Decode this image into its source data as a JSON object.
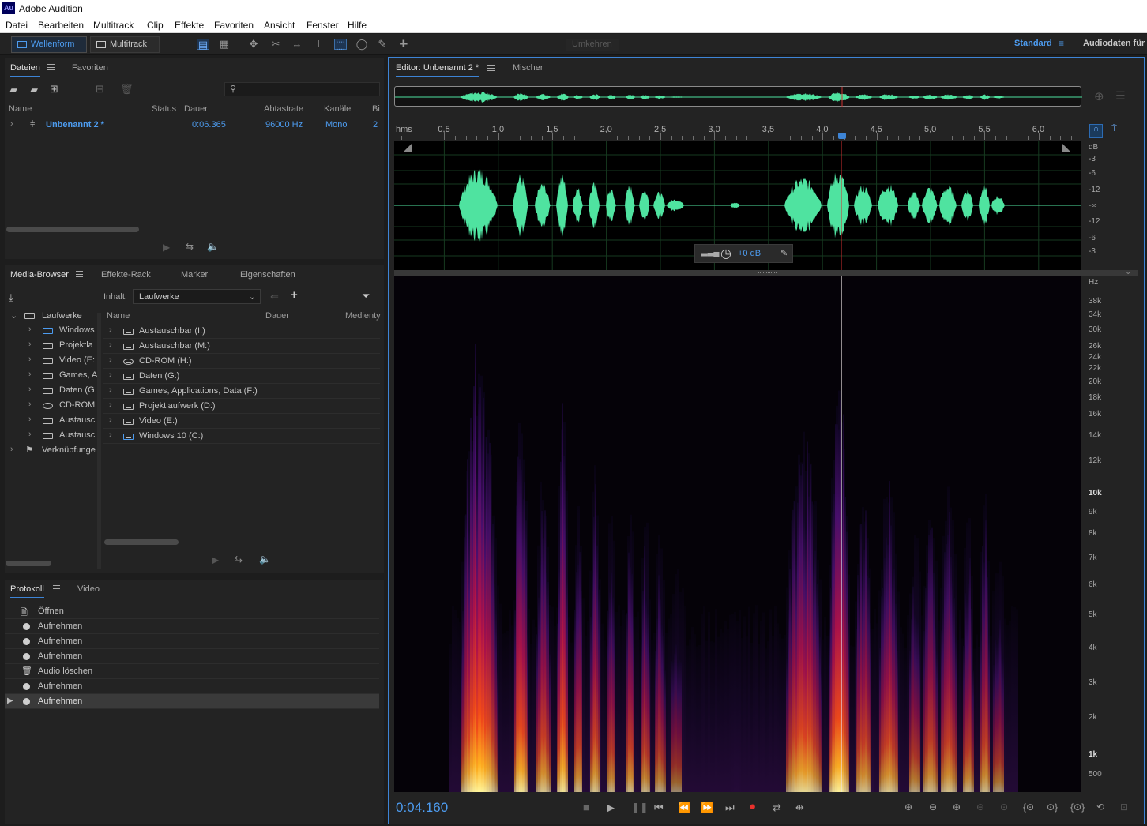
{
  "app": {
    "title": "Adobe Audition",
    "logo": "Au"
  },
  "menu": [
    "Datei",
    "Bearbeiten",
    "Multitrack",
    "Clip",
    "Effekte",
    "Favoriten",
    "Ansicht",
    "Fenster",
    "Hilfe"
  ],
  "toolbar": {
    "waveform_label": "Wellenform",
    "multitrack_label": "Multitrack",
    "reverse_label": "Umkehren",
    "workspace_label": "Standard",
    "workspace_next": "Audiodaten für V"
  },
  "files_panel": {
    "tabs": [
      "Dateien",
      "Favoriten"
    ],
    "columns": [
      "Name",
      "Status",
      "Dauer",
      "Abtastrate",
      "Kanäle",
      "Bi"
    ],
    "rows": [
      {
        "name": "Unbenannt 2 *",
        "status": "",
        "duration": "0:06.365",
        "rate": "96000 Hz",
        "channels": "Mono",
        "bits": "2"
      }
    ]
  },
  "media_panel": {
    "tabs": [
      "Media-Browser",
      "Effekte-Rack",
      "Marker",
      "Eigenschaften"
    ],
    "content_label": "Inhalt:",
    "content_value": "Laufwerke",
    "columns": [
      "Name",
      "Dauer",
      "Medienty"
    ],
    "tree_root": "Laufwerke",
    "tree_items": [
      "Windows",
      "Projektla",
      "Video (E:",
      "Games, A",
      "Daten (G",
      "CD-ROM",
      "Austausc",
      "Austausc"
    ],
    "tree_links": "Verknüpfunge",
    "list_items": [
      "Austauschbar (I:)",
      "Austauschbar (M:)",
      "CD-ROM (H:)",
      "Daten (G:)",
      "Games, Applications, Data (F:)",
      "Projektlaufwerk (D:)",
      "Video (E:)",
      "Windows 10 (C:)"
    ]
  },
  "history_panel": {
    "tabs": [
      "Protokoll",
      "Video"
    ],
    "items": [
      "Öffnen",
      "Aufnehmen",
      "Aufnehmen",
      "Aufnehmen",
      "Audio löschen",
      "Aufnehmen",
      "Aufnehmen"
    ]
  },
  "editor": {
    "tabs": [
      "Editor: Unbenannt 2 *",
      "Mischer"
    ],
    "ruler_unit": "hms",
    "ruler_labels": [
      "0,5",
      "1,0",
      "1,5",
      "2,0",
      "2,5",
      "3,0",
      "3,5",
      "4,0",
      "4,5",
      "5,0",
      "5,5",
      "6,0"
    ],
    "db_labels": [
      "dB",
      "-3",
      "-6",
      "-12",
      "-∞",
      "-12",
      "-6",
      "-3"
    ],
    "hz_labels": [
      "Hz",
      "38k",
      "34k",
      "30k",
      "26k",
      "24k",
      "22k",
      "20k",
      "18k",
      "16k",
      "14k",
      "12k",
      "10k",
      "9k",
      "8k",
      "7k",
      "6k",
      "5k",
      "4k",
      "3k",
      "2k",
      "1k",
      "500"
    ],
    "gain": "+0 dB",
    "timecode": "0:04.160"
  },
  "colors": {
    "accent": "#3d84d6",
    "waveform": "#4fe3a0",
    "playhead": "#d03030"
  }
}
